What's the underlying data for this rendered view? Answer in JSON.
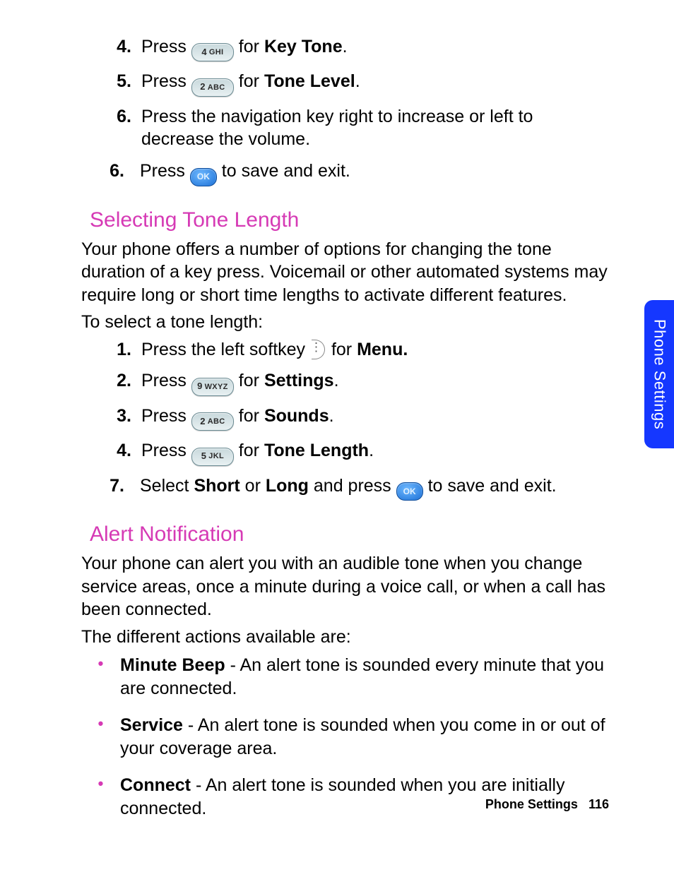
{
  "steps_top": [
    {
      "num": "4.",
      "pre": "Press ",
      "key_big": "4",
      "key_small": "GHI",
      "mid": " for ",
      "bold": "Key Tone",
      "post": "."
    },
    {
      "num": "5.",
      "pre": "Press ",
      "key_big": "2",
      "key_small": "ABC",
      "mid": " for ",
      "bold": "Tone Level",
      "post": "."
    },
    {
      "num": "6.",
      "text": "Press the navigation key right to increase or left to decrease the volume."
    }
  ],
  "step_top_ok": {
    "num": "6.",
    "pre": "Press ",
    "ok": "OK",
    "post": " to save and exit."
  },
  "section1": {
    "heading": "Selecting Tone Length",
    "body1": "Your phone offers a number of options for changing the tone duration of a key press. Voicemail or other automated systems may require long or short time lengths to activate different features.",
    "body2": "To select a tone length:",
    "steps": [
      {
        "num": "1.",
        "pre": "Press the left softkey ",
        "type": "softkey",
        "mid": " for ",
        "bold": "Menu."
      },
      {
        "num": "2.",
        "pre": "Press ",
        "key_big": "9",
        "key_small": "WXYZ",
        "mid": " for ",
        "bold": "Settings",
        "post": "."
      },
      {
        "num": "3.",
        "pre": "Press ",
        "key_big": "2",
        "key_small": "ABC",
        "mid": " for ",
        "bold": "Sounds",
        "post": "."
      },
      {
        "num": "4.",
        "pre": "Press ",
        "key_big": "5",
        "key_small": "JKL",
        "mid": " for ",
        "bold": "Tone Length",
        "post": "."
      }
    ],
    "step_final": {
      "num": "7.",
      "pre": "Select ",
      "b1": "Short",
      "mid1": " or ",
      "b2": "Long",
      "mid2": " and press ",
      "ok": "OK",
      "post": " to save and exit."
    }
  },
  "section2": {
    "heading": "Alert Notification",
    "body1": "Your phone can alert you with an audible tone when you change service areas, once a minute during a voice call, or when a call has been connected.",
    "body2": "The different actions available are:",
    "bullets": [
      {
        "bold": "Minute Beep",
        "text": " - An alert tone is sounded every minute that you are connected."
      },
      {
        "bold": "Service",
        "text": " - An alert tone is sounded when you come in or out of your coverage area."
      },
      {
        "bold": "Connect",
        "text": " - An alert tone is sounded when you are initially connected."
      }
    ]
  },
  "side_tab": "Phone Settings",
  "footer": {
    "section": "Phone Settings",
    "page": "116"
  }
}
